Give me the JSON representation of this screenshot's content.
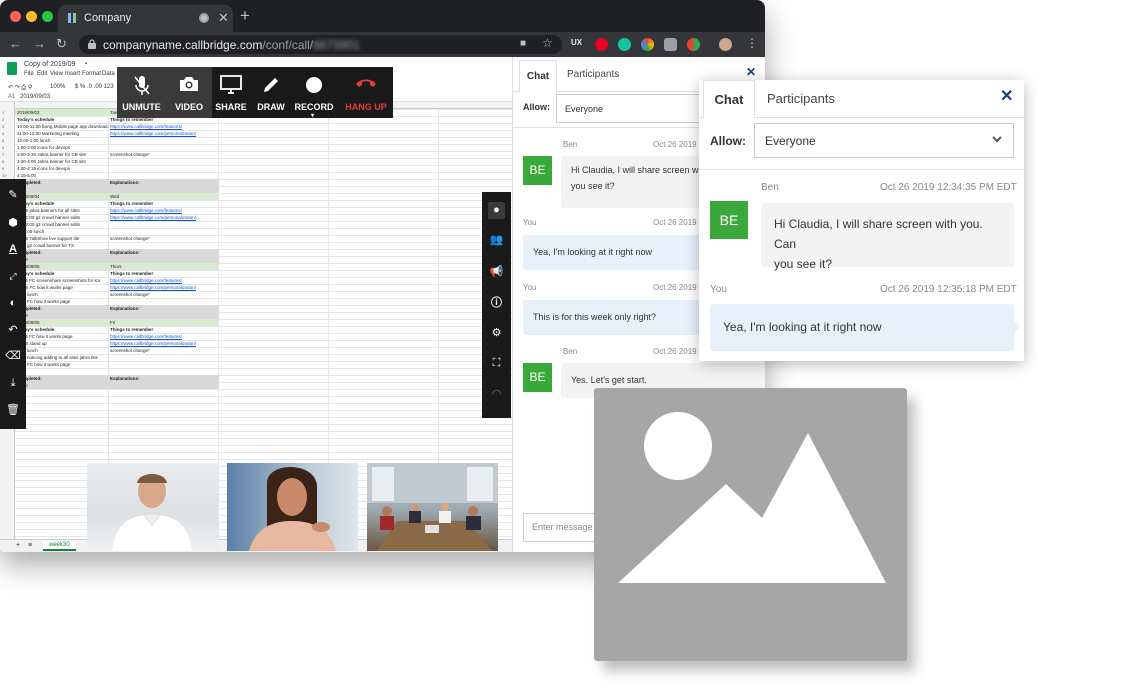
{
  "browser": {
    "tab_title": "Company",
    "url_domain": "companyname.callbridge.com",
    "url_path": "/conf/call/",
    "url_suffix": "6673901"
  },
  "sheet": {
    "doc_title": "Copy of 2019/09",
    "menu": [
      "File",
      "Edit",
      "View",
      "Insert",
      "Format",
      "Data"
    ],
    "zoom": "100%",
    "cell_ref": "A1",
    "formula_value": "2019/09/03",
    "sheet_tab": "week30",
    "rows": [
      {
        "a": "2019/09/03",
        "b": "Tue"
      },
      {
        "a": "Today's schedule",
        "b": "Things to remember"
      },
      {
        "a": "10:00-11:00 fixing Mobile page app download",
        "b": "https://www.callbridge.com/features/"
      },
      {
        "a": "11:00-12:00 Marketing meeting",
        "b": "https://www.callbridge.com/personalization/"
      },
      {
        "a": "12:00-1:00 lunch",
        "b": ""
      },
      {
        "a": "1:00-3:00 icons for devops",
        "b": ""
      },
      {
        "a": "3:00-3:30 Jabra banner for CB site",
        "b": "screenshot change*"
      },
      {
        "a": "3:30-4:00 Jabra banner for CB site",
        "b": ""
      },
      {
        "a": "4:00-4:15 icons for devops",
        "b": ""
      },
      {
        "a": "4:15-5:00",
        "b": ""
      },
      {
        "a": "Completed:",
        "b": "Explanations:"
      },
      {
        "a": "",
        "b": ""
      },
      {
        "a": "2019/09/04",
        "b": "Wed"
      },
      {
        "a": "Today's schedule",
        "b": "Things to remember"
      },
      {
        "a": "10:00 jabra banners for all sites",
        "b": "https://www.callbridge.com/features/"
      },
      {
        "a": "10-11:00 g2 crowd banner edits",
        "b": "https://www.callbridge.com/personalization/"
      },
      {
        "a": "11-12:00 g2 crowd banner edits",
        "b": ""
      },
      {
        "a": "12-1:00 lunch",
        "b": ""
      },
      {
        "a": "12:30 TalkShoe live support tile",
        "b": "screenshot change*"
      },
      {
        "a": "5:00 g2 crowd banner for TS",
        "b": ""
      },
      {
        "a": "Completed:",
        "b": "Explanations:"
      },
      {
        "a": "None",
        "b": ""
      },
      {
        "a": "2019/09/05",
        "b": "Thurs"
      },
      {
        "a": "Today's schedule",
        "b": "Things to remember"
      },
      {
        "a": "11:45 FC screenshare screenshots for Ka",
        "b": "https://www.callbridge.com/features/"
      },
      {
        "a": "12:00 FC how it works page",
        "b": "https://www.callbridge.com/personalization/"
      },
      {
        "a": "1:00 lunch",
        "b": "screenshot change*"
      },
      {
        "a": "5:00 FC how it works page",
        "b": ""
      },
      {
        "a": "Completed:",
        "b": "Explanations:"
      },
      {
        "a": "None",
        "b": ""
      },
      {
        "a": "2019/09/06",
        "b": "Fri"
      },
      {
        "a": "Today's schedule",
        "b": "Things to remember"
      },
      {
        "a": "11:45 FC how it works page",
        "b": "https://www.callbridge.com/features/"
      },
      {
        "a": "12:00 stand up",
        "b": "https://www.callbridge.com/personalization/"
      },
      {
        "a": "1:00 lunch",
        "b": "screenshot change*"
      },
      {
        "a": "3:10 noticing adding to all sites jabra link",
        "b": ""
      },
      {
        "a": "4:00 FC how it works page",
        "b": ""
      },
      {
        "a": "5:00",
        "b": ""
      },
      {
        "a": "Completed:",
        "b": "Explanations:"
      },
      {
        "a": "None",
        "b": ""
      }
    ]
  },
  "callbar": {
    "unmute": "UNMUTE",
    "video": "VIDEO",
    "share": "SHARE",
    "draw": "DRAW",
    "record": "RECORD",
    "hangup": "HANG UP"
  },
  "chat": {
    "tab_chat": "Chat",
    "tab_participants": "Participants",
    "allow_label": "Allow:",
    "allow_value": "Everyone",
    "input_placeholder": "Enter message",
    "messages": [
      {
        "name": "Ben",
        "time": "Oct 26 2019 1",
        "avatar": "BE",
        "text1": "Hi Claudia, I will share screen wi",
        "text2": "you see it?"
      },
      {
        "name": "You",
        "time": "Oct 26 2019 1",
        "text1": "Yea, I'm looking at it right now"
      },
      {
        "name": "You",
        "time": "Oct 26 2019 1",
        "text1": "This is for this week only right?"
      },
      {
        "name": "Ben",
        "time": "Oct 26 2019 1",
        "avatar": "BE",
        "text1": "Yes. Let's get start."
      }
    ]
  },
  "popup": {
    "tab_chat": "Chat",
    "tab_participants": "Participants",
    "allow_label": "Allow:",
    "allow_value": "Everyone",
    "msg1_name": "Ben",
    "msg1_time": "Oct 26 2019 12:34:35 PM EDT",
    "msg1_avatar": "BE",
    "msg1_text1": "Hi Claudia, I will share screen with you. Can",
    "msg1_text2": "you see it?",
    "msg2_name": "You",
    "msg2_time": "Oct 26 2019 12:35:18 PM EDT",
    "msg2_text": "Yea, I'm looking at it right now"
  },
  "colors": {
    "accent_blue": "#1d3f73",
    "avatar_green": "#3aa83a",
    "hangup_red": "#e33b3b",
    "my_bubble": "#e8f1fb",
    "placeholder_gray": "#a6a6a6"
  },
  "icons": {
    "left_tools": [
      "pencil-icon",
      "cube-icon",
      "text-icon",
      "expand-icon",
      "eraser-icon",
      "undo-icon",
      "eraser-icon",
      "download-icon",
      "trash-icon"
    ],
    "right_tools": [
      "chat-icon",
      "participants-icon",
      "megaphone-icon",
      "info-icon",
      "gear-icon",
      "fullscreen-icon",
      "wifi-icon"
    ]
  }
}
